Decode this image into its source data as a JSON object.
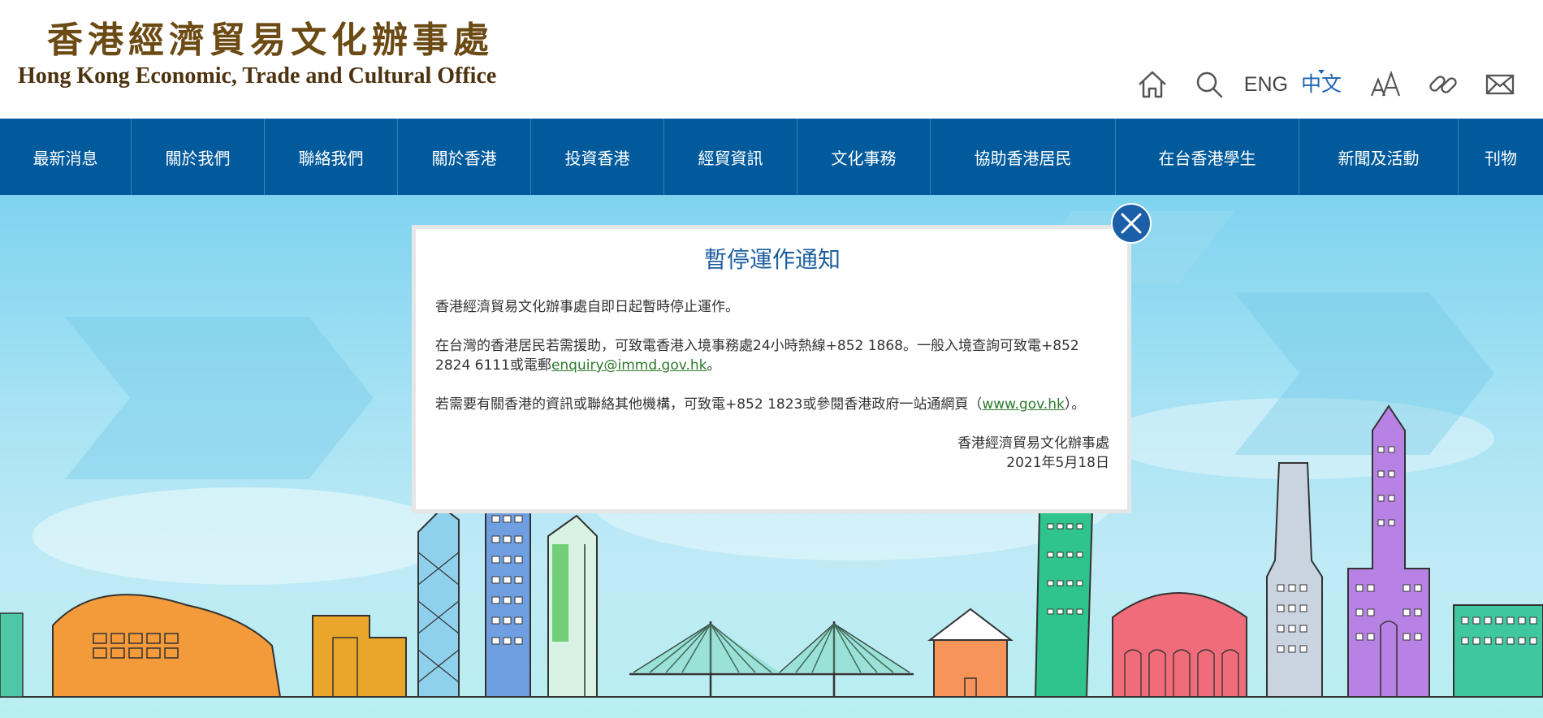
{
  "header": {
    "logo_cn": "香港經濟貿易文化辦事處",
    "logo_en": "Hong Kong Economic, Trade and Cultural Office",
    "lang_en": "ENG",
    "lang_zh": "中文",
    "icons": [
      "home-icon",
      "search-icon",
      "font-size-icon",
      "link-icon",
      "mail-icon"
    ]
  },
  "nav": {
    "items": [
      {
        "label": "最新消息"
      },
      {
        "label": "關於我們"
      },
      {
        "label": "聯絡我們"
      },
      {
        "label": "關於香港"
      },
      {
        "label": "投資香港"
      },
      {
        "label": "經貿資訊"
      },
      {
        "label": "文化事務"
      },
      {
        "label": "協助香港居民"
      },
      {
        "label": "在台香港學生"
      },
      {
        "label": "新聞及活動"
      },
      {
        "label": "刊物"
      }
    ]
  },
  "modal": {
    "title": "暫停運作通知",
    "para1": "香港經濟貿易文化辦事處自即日起暫時停止運作。",
    "para2_pre": "在台灣的香港居民若需援助，可致電香港入境事務處24小時熱線+852 1868。一般入境查詢可致電+852 2824 6111或電郵",
    "para2_link": "enquiry@immd.gov.hk",
    "para2_post": "。",
    "para3_pre": "若需要有關香港的資訊或聯絡其他機構，可致電+852 1823或參閱香港政府一站通網頁（",
    "para3_link": "www.gov.hk",
    "para3_post": "）。",
    "sign_org": "香港經濟貿易文化辦事處",
    "sign_date": "2021年5月18日"
  },
  "colors": {
    "nav_bg": "#005a9c",
    "title": "#1d5f9e",
    "link": "#2d7a2d",
    "close_bg": "#1a5fa8",
    "lang_active": "#1d64b0"
  }
}
